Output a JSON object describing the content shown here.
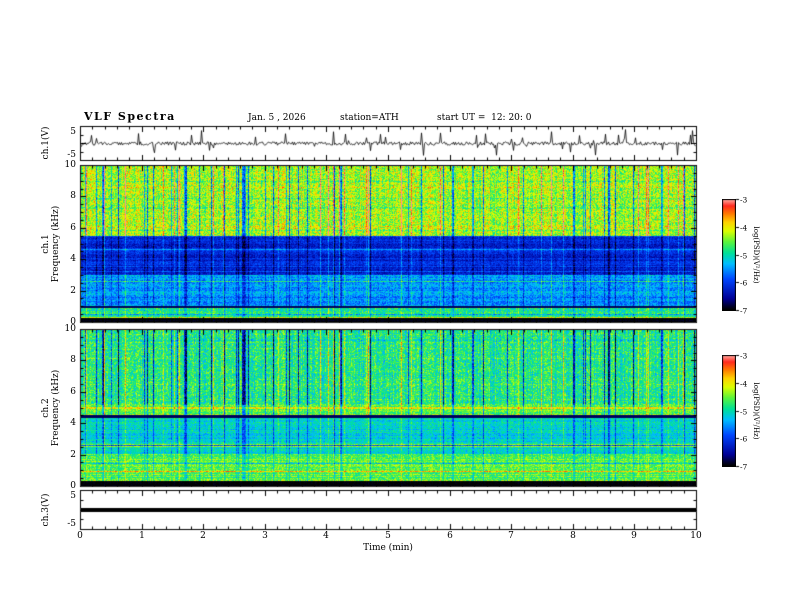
{
  "chart_data": {
    "type": "heatmap",
    "title": "VLF Spectra",
    "header": {
      "date": "Jan. 5 , 2026",
      "station": "station=ATH",
      "start_ut": "start UT =  12: 20: 0"
    },
    "x_axis": {
      "label": "Time (min)",
      "min": 0,
      "max": 10,
      "major_ticks": [
        0,
        1,
        2,
        3,
        4,
        5,
        6,
        7,
        8,
        9,
        10
      ],
      "minor_step": 0.2
    },
    "colorbar": {
      "label": "log(PSD)(V²/Hz)",
      "min": -7,
      "max": -3,
      "ticks": [
        -3,
        -4,
        -5,
        -6,
        -7
      ]
    },
    "panels": [
      {
        "id": "ch1_waveform",
        "kind": "line",
        "channel": "ch.1(V)",
        "y_min": -5,
        "y_max": 5,
        "y_major_ticks": [
          -5,
          0,
          5
        ],
        "y_minor_step": 2.5,
        "y_tick_labels": [
          5,
          -5
        ],
        "signal_summary": "Broadband noise around 0 V with dense impulsive spikes reaching about ±4 V over the whole 10 min record"
      },
      {
        "id": "ch1_spectrogram",
        "kind": "spectrogram",
        "channel": "ch.1",
        "ylabel": "Frequency (kHz)",
        "y_min": 0,
        "y_max": 10,
        "y_major_ticks": [
          0,
          2,
          4,
          6,
          8,
          10
        ],
        "y_minor_step": 0.5,
        "dark_lines_khz": [
          0.95
        ],
        "bands": [
          {
            "f_khz": [
              5.5,
              10
            ],
            "mean_log_psd": -4.3,
            "texture": "bright green-yellow with dense red and dark-blue vertical sferic streaks"
          },
          {
            "f_khz": [
              3.0,
              5.5
            ],
            "mean_log_psd": -6.2,
            "texture": "dark blue with cyan horizontal interference lines"
          },
          {
            "f_khz": [
              1.0,
              3.0
            ],
            "mean_log_psd": -5.5,
            "texture": "blue-cyan with horizontal striping"
          },
          {
            "f_khz": [
              0.2,
              1.0
            ],
            "mean_log_psd": -4.8,
            "texture": "green-yellow horizontal banding"
          },
          {
            "f_khz": [
              0.0,
              0.2
            ],
            "mean_log_psd": -7.0,
            "texture": "black band at lowest frequencies"
          }
        ]
      },
      {
        "id": "ch2_spectrogram",
        "kind": "spectrogram",
        "channel": "ch.2",
        "ylabel": "Frequency (kHz)",
        "y_min": 0,
        "y_max": 10,
        "y_major_ticks": [
          0,
          2,
          4,
          6,
          8,
          10
        ],
        "y_minor_step": 0.5,
        "dark_lines_khz": [
          4.45
        ],
        "bands": [
          {
            "f_khz": [
              5.2,
              10
            ],
            "mean_log_psd": -4.8,
            "texture": "green with dense dark-blue vertical sferic streaks and yellow patches"
          },
          {
            "f_khz": [
              4.4,
              5.2
            ],
            "mean_log_psd": -4.5,
            "texture": "yellow-green band bounded by a dark line near 4.5 kHz"
          },
          {
            "f_khz": [
              2.0,
              4.4
            ],
            "mean_log_psd": -5.1,
            "texture": "cyan-green with horizontal striping"
          },
          {
            "f_khz": [
              0.3,
              2.0
            ],
            "mean_log_psd": -4.6,
            "texture": "green-yellow strong horizontal banding with sparse red specks"
          },
          {
            "f_khz": [
              0.0,
              0.3
            ],
            "mean_log_psd": -7.0,
            "texture": "black band at lowest frequencies"
          }
        ]
      },
      {
        "id": "ch3_waveform",
        "kind": "line",
        "channel": "ch.3(V)",
        "y_min": -5,
        "y_max": 5,
        "y_major_ticks": [
          -5,
          0,
          5
        ],
        "y_minor_step": 2.5,
        "y_tick_labels": [
          5,
          -5
        ],
        "signal_summary": "Flat heavy line at 0 V (no signal on channel 3)"
      }
    ]
  }
}
